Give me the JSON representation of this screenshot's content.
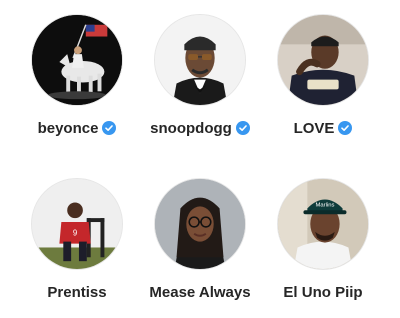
{
  "accounts": [
    {
      "username": "beyonce",
      "verified": true,
      "avatar_icon": "horse-rider-flag-photo"
    },
    {
      "username": "snoopdogg",
      "verified": true,
      "avatar_icon": "man-sunglasses-bowtie-photo"
    },
    {
      "username": "LOVE",
      "verified": true,
      "avatar_icon": "man-vondutch-shirt-photo"
    },
    {
      "username": "Prentiss",
      "verified": false,
      "avatar_icon": "man-red-shirt-chair-photo"
    },
    {
      "username": "Mease Always",
      "verified": false,
      "avatar_icon": "woman-glasses-photo"
    },
    {
      "username": "El Uno Piip",
      "verified": false,
      "avatar_icon": "man-marlins-cap-photo"
    }
  ],
  "colors": {
    "verified_badge": "#3897f0",
    "text": "#262626"
  }
}
